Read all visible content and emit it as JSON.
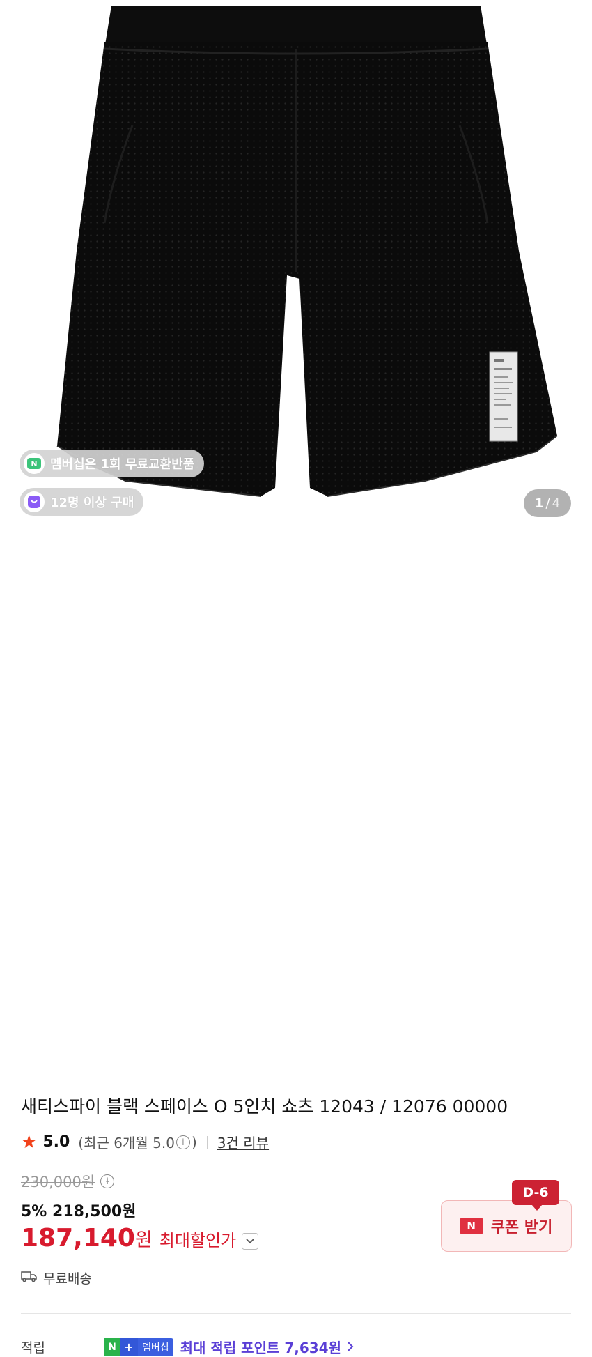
{
  "badges": {
    "membership": "멤버십은 1회 무료교환반품",
    "purchases": "12명 이상 구매"
  },
  "gallery": {
    "current": "1",
    "separator": "/",
    "total": "4"
  },
  "product": {
    "title": "새티스파이 블랙 스페이스 O 5인치 쇼츠 12043 / 12076 00000",
    "rating": "5.0",
    "recent_rating": "(최근 6개월 5.0",
    "recent_rating_close": ")",
    "reviews": "3건 리뷰"
  },
  "price": {
    "original": "230,000원",
    "discount": "5% 218,500원",
    "max_price": "187,140",
    "max_unit": "원",
    "max_label": "최대할인가"
  },
  "coupon": {
    "label": "쿠폰 받기",
    "dday": "D-6",
    "logo": "N"
  },
  "shipping": {
    "label": "무료배송"
  },
  "points": {
    "label": "적립",
    "badge_n": "N",
    "badge_plus": "+",
    "badge_member": "멤버십",
    "text": "최대 적립 포인트 7,634원"
  },
  "colors": {
    "accent_red": "#d81b2e",
    "points_purple": "#5a3fd6",
    "star": "#f2421b"
  },
  "icons": [
    "membership-n-icon",
    "shopping-bag-icon",
    "star-icon",
    "info-icon",
    "chevron-down-icon",
    "naver-n-icon",
    "truck-icon",
    "chevron-right-icon"
  ]
}
